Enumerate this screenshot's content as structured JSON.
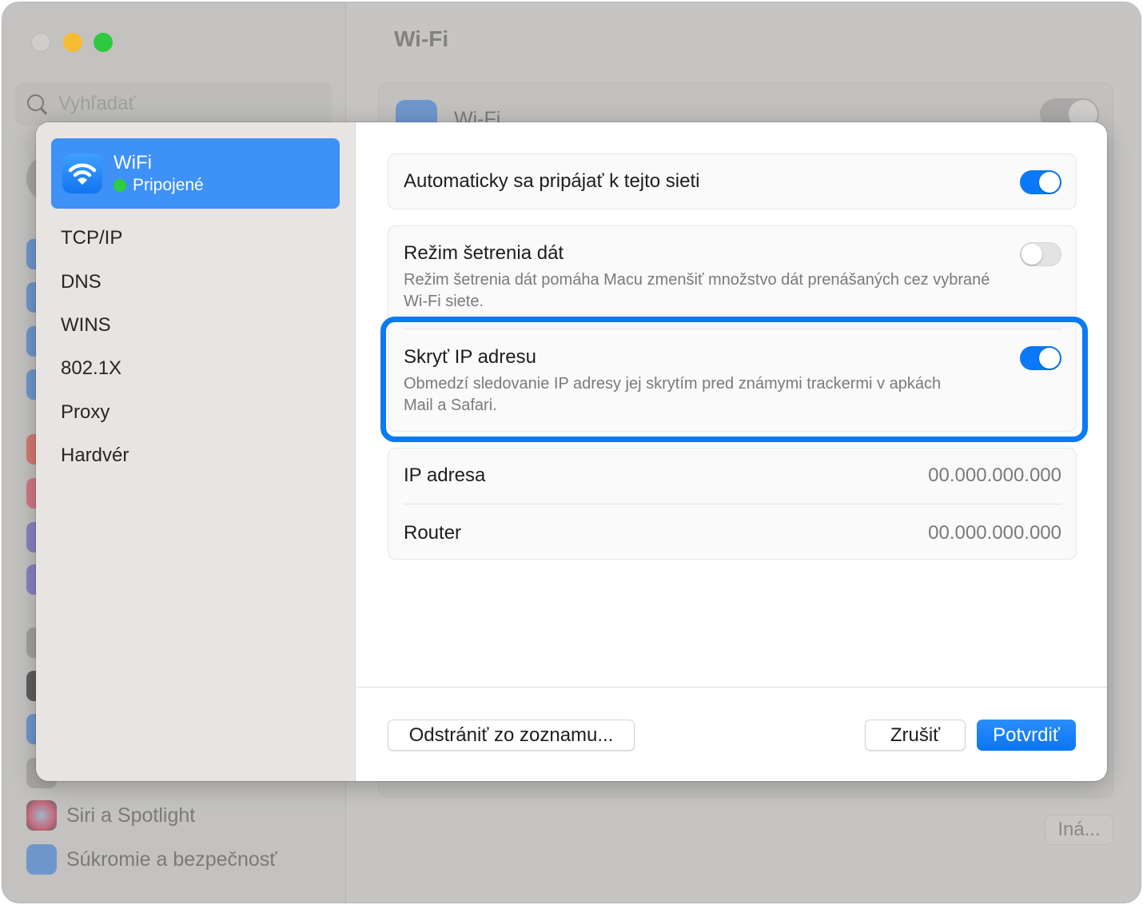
{
  "background_window": {
    "search_placeholder": "Vyhľadať",
    "main_title": "Wi-Fi",
    "wifi_row_label": "Wi-Fi",
    "wifi_toggle_on": false,
    "sidebar_visible_items": [
      {
        "label": "Siri a Spotlight",
        "icon": "siri-icon"
      },
      {
        "label": "Súkromie a bezpečnosť",
        "icon": "hand-icon"
      }
    ],
    "other_button_label": "Iná..."
  },
  "dialog": {
    "sidebar": {
      "selected": {
        "title": "WiFi",
        "status": "Pripojené",
        "status_color": "#2ecc40",
        "icon": "wifi-icon"
      },
      "items": [
        {
          "label": "TCP/IP"
        },
        {
          "label": "DNS"
        },
        {
          "label": "WINS"
        },
        {
          "label": "802.1X"
        },
        {
          "label": "Proxy"
        },
        {
          "label": "Hardvér"
        }
      ]
    },
    "settings": {
      "auto_join": {
        "label": "Automaticky sa pripájať k tejto sieti",
        "enabled": true
      },
      "low_data": {
        "label": "Režim šetrenia dát",
        "description": "Režim šetrenia dát pomáha Macu zmenšiť množstvo dát prenášaných cez vybrané Wi-Fi siete.",
        "enabled": false
      },
      "hide_ip": {
        "label": "Skryť IP adresu",
        "description": "Obmedzí sledovanie IP adresy jej skrytím pred známymi trackermi v apkách Mail a Safari.",
        "enabled": true,
        "highlighted": true
      }
    },
    "info": [
      {
        "label": "IP adresa",
        "value": "00.000.000.000"
      },
      {
        "label": "Router",
        "value": "00.000.000.000"
      }
    ],
    "buttons": {
      "forget": "Odstrániť zo zoznamu...",
      "cancel": "Zrušiť",
      "ok": "Potvrdiť"
    },
    "accent_color": "#0a78f7"
  }
}
